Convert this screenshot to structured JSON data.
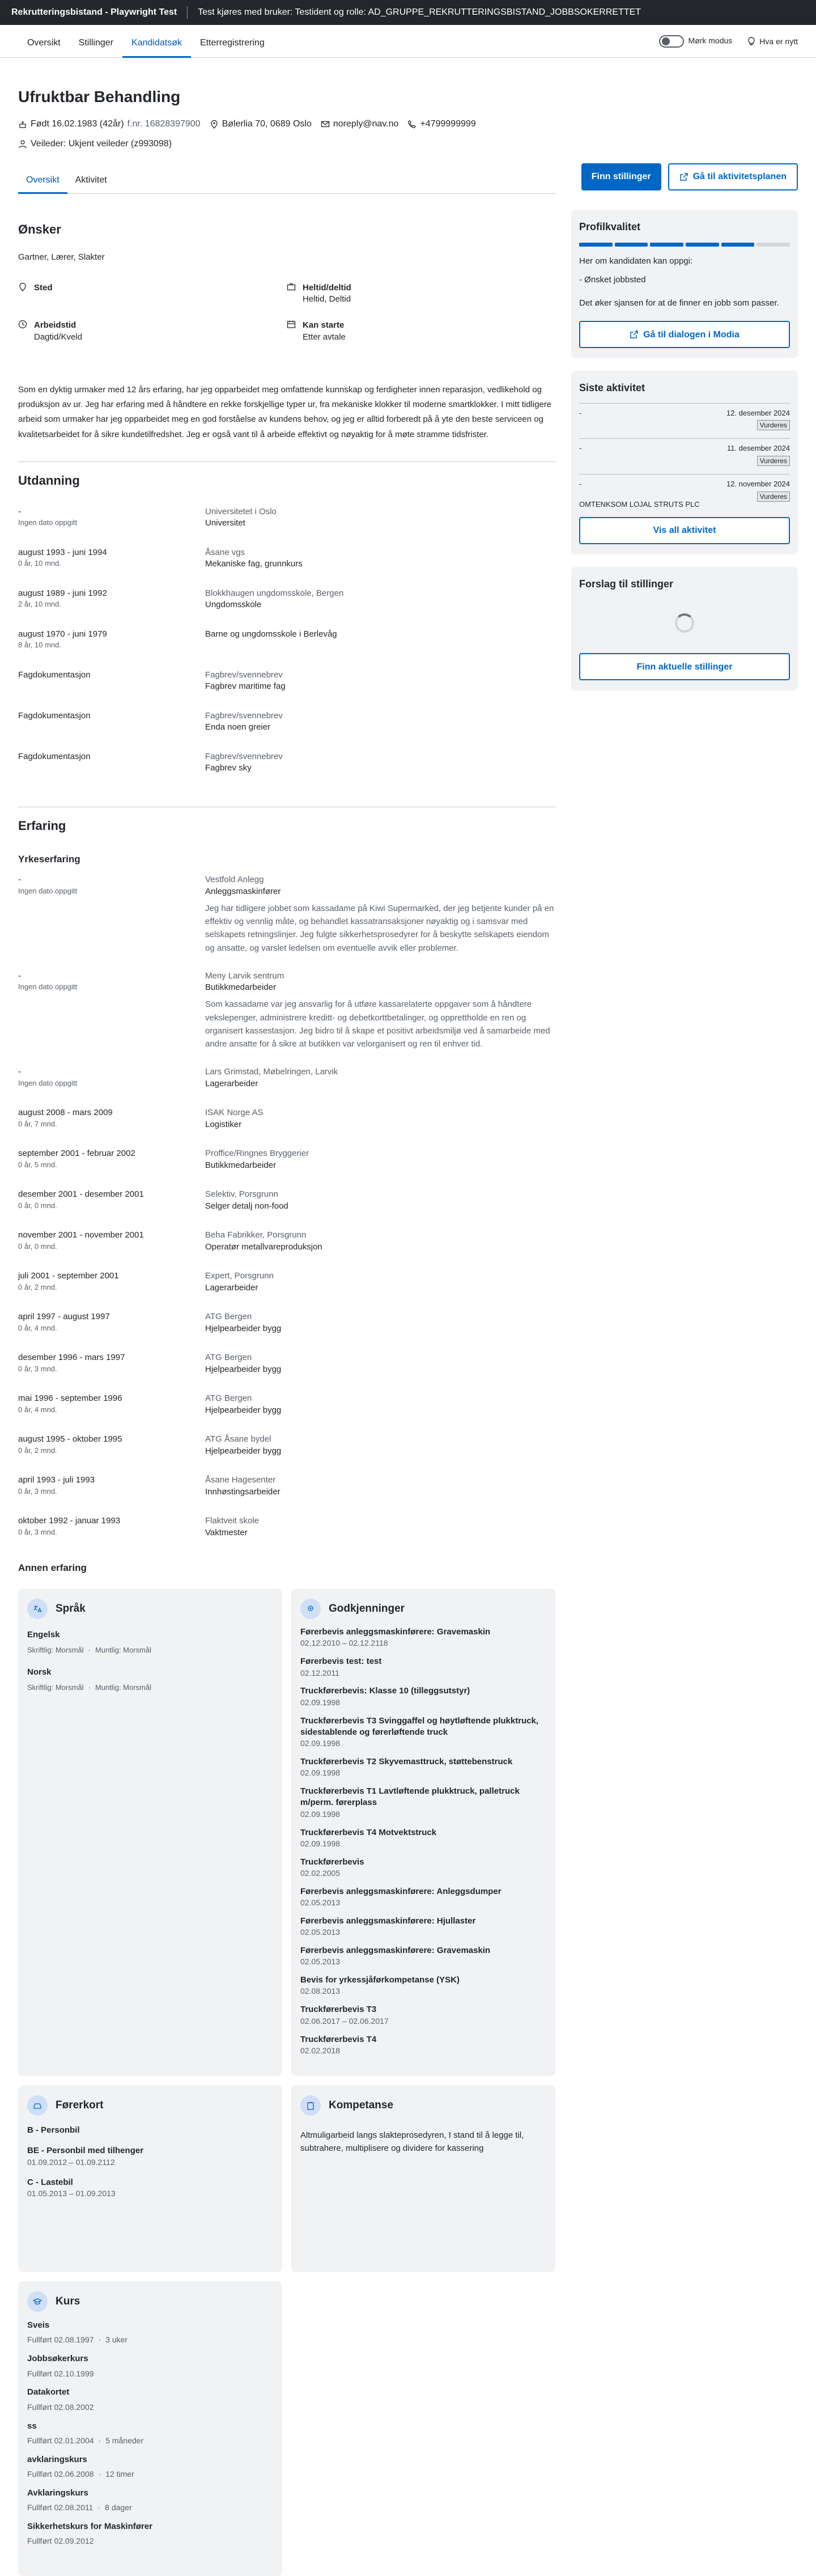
{
  "topbar": {
    "app": "Rekrutteringsbistand - Playwright Test",
    "info": "Test kjøres med bruker: Testident og rolle: AD_GRUPPE_REKRUTTERINGSBISTAND_JOBBSOKERRETTET"
  },
  "nav": {
    "tabs": [
      "Oversikt",
      "Stillinger",
      "Kandidatsøk",
      "Etterregistrering"
    ],
    "active": 2,
    "dark_mode": "Mørk modus",
    "whats_new": "Hva er nytt"
  },
  "candidate": {
    "name": "Ufruktbar Behandling",
    "born": "Født 16.02.1983 (42år)",
    "fnr": "f.nr. 16828397900",
    "address": "Bølerlia 70, 0689 Oslo",
    "email": "noreply@nav.no",
    "phone": "+4799999999",
    "veileder": "Veileder: Ukjent veileder (z993098)"
  },
  "subtabs": [
    "Oversikt",
    "Aktivitet"
  ],
  "buttons": {
    "find_jobs": "Finn stillinger",
    "activity_plan": "Gå til aktivitetsplanen"
  },
  "wishes": {
    "heading": "Ønsker",
    "jobs": "Gartner, Lærer, Slakter",
    "place_label": "Sted",
    "place_value": "",
    "work_label": "Heltid/deltid",
    "work_value": "Heltid, Deltid",
    "time_label": "Arbeidstid",
    "time_value": "Dagtid/Kveld",
    "start_label": "Kan starte",
    "start_value": "Etter avtale"
  },
  "about": "Som en dyktig urmaker med 12 års erfaring, har jeg opparbeidet meg omfattende kunnskap og ferdigheter innen reparasjon, vedlikehold og produksjon av ur. Jeg har erfaring med å håndtere en rekke forskjellige typer ur, fra mekaniske klokker til moderne smartklokker. I mitt tidligere arbeid som urmaker har jeg opparbeidet meg en god forståelse av kundens behov, og jeg er alltid forberedt på å yte den beste serviceen og kvalitetsarbeidet for å sikre kundetilfredshet. Jeg er også vant til å arbeide effektivt og nøyaktig for å møte stramme tidsfrister.",
  "education": {
    "heading": "Utdanning",
    "items": [
      {
        "date": "-",
        "sub": "Ingen dato oppgitt",
        "org": "Universitetet i Oslo",
        "title": "Universitet"
      },
      {
        "date": "august 1993 - juni 1994",
        "sub": "0 år, 10 mnd.",
        "org": "Åsane vgs",
        "title": "Mekaniske fag, grunnkurs"
      },
      {
        "date": "august 1989 - juni 1992",
        "sub": "2 år, 10 mnd.",
        "org": "Blokkhaugen ungdomsskole, Bergen",
        "title": "Ungdomsskole"
      },
      {
        "date": "august 1970 - juni 1979",
        "sub": "8 år, 10 mnd.",
        "org": "",
        "title": "Barne og ungdomsskole i Berlevåg"
      },
      {
        "date": "Fagdokumentasjon",
        "sub": "",
        "org": "Fagbrev/svennebrev",
        "title": "Fagbrev maritime fag"
      },
      {
        "date": "Fagdokumentasjon",
        "sub": "",
        "org": "Fagbrev/svennebrev",
        "title": "Enda noen greier"
      },
      {
        "date": "Fagdokumentasjon",
        "sub": "",
        "org": "Fagbrev/svennebrev",
        "title": "Fagbrev sky"
      }
    ]
  },
  "experience": {
    "heading": "Erfaring",
    "subheading": "Yrkeserfaring",
    "other": "Annen erfaring",
    "items": [
      {
        "date": "-",
        "sub": "Ingen dato oppgitt",
        "org": "Vestfold Anlegg",
        "title": "Anleggsmaskinfører",
        "desc": "Jeg har tidligere jobbet som kassadame på Kiwi Supermarked, der jeg betjente kunder på en effektiv og vennlig måte, og behandlet kassatransaksjoner nøyaktig og i samsvar med selskapets retningslinjer. Jeg fulgte sikkerhetsprosedyrer for å beskytte selskapets eiendom og ansatte, og varslet ledelsen om eventuelle avvik eller problemer."
      },
      {
        "date": "-",
        "sub": "Ingen dato oppgitt",
        "org": "Meny Larvik sentrum",
        "title": "Butikkmedarbeider",
        "desc": "Som kassadame var jeg ansvarlig for å utføre kassarelaterte oppgaver som å håndtere vekslepenger, administrere kreditt- og debetkorttbetalinger, og opprettholde en ren og organisert kassestasjon. Jeg bidro til å skape et positivt arbeidsmiljø ved å samarbeide med andre ansatte for å sikre at butikken var velorganisert og ren til enhver tid."
      },
      {
        "date": "-",
        "sub": "Ingen dato oppgitt",
        "org": "Lars Grimstad, Møbelringen, Larvik",
        "title": "Lagerarbeider",
        "desc": ""
      },
      {
        "date": "august 2008 - mars 2009",
        "sub": "0 år, 7 mnd.",
        "org": "ISAK Norge AS",
        "title": "Logistiker",
        "desc": ""
      },
      {
        "date": "september 2001 - februar 2002",
        "sub": "0 år, 5 mnd.",
        "org": "Proffice/Ringnes Bryggerier",
        "title": "Butikkmedarbeider",
        "desc": ""
      },
      {
        "date": "desember 2001 - desember 2001",
        "sub": "0 år, 0 mnd.",
        "org": "Selektiv, Porsgrunn",
        "title": "Selger detalj non-food",
        "desc": ""
      },
      {
        "date": "november 2001 - november 2001",
        "sub": "0 år, 0 mnd.",
        "org": "Beha Fabrikker, Porsgrunn",
        "title": "Operatør metallvareproduksjon",
        "desc": ""
      },
      {
        "date": "juli 2001 - september 2001",
        "sub": "0 år, 2 mnd.",
        "org": "Expert, Porsgrunn",
        "title": "Lagerarbeider",
        "desc": ""
      },
      {
        "date": "april 1997 - august 1997",
        "sub": "0 år, 4 mnd.",
        "org": "ATG Bergen",
        "title": "Hjelpearbeider bygg",
        "desc": ""
      },
      {
        "date": "desember 1996 - mars 1997",
        "sub": "0 år, 3 mnd.",
        "org": "ATG Bergen",
        "title": "Hjelpearbeider bygg",
        "desc": ""
      },
      {
        "date": "mai 1996 - september 1996",
        "sub": "0 år, 4 mnd.",
        "org": "ATG Bergen",
        "title": "Hjelpearbeider bygg",
        "desc": ""
      },
      {
        "date": "august 1995 - oktober 1995",
        "sub": "0 år, 2 mnd.",
        "org": "ATG Åsane bydel",
        "title": "Hjelpearbeider bygg",
        "desc": ""
      },
      {
        "date": "april 1993 - juli 1993",
        "sub": "0 år, 3 mnd.",
        "org": "Åsane Hagesenter",
        "title": "Innhøstingsarbeider",
        "desc": ""
      },
      {
        "date": "oktober 1992 - januar 1993",
        "sub": "0 år, 3 mnd.",
        "org": "Flaktveit skole",
        "title": "Vaktmester",
        "desc": ""
      }
    ]
  },
  "languages": {
    "heading": "Språk",
    "items": [
      {
        "name": "Engelsk",
        "written": "Skriftlig: Morsmål",
        "oral": "Muntlig: Morsmål"
      },
      {
        "name": "Norsk",
        "written": "Skriftlig: Morsmål",
        "oral": "Muntlig: Morsmål"
      }
    ]
  },
  "approvals": {
    "heading": "Godkjenninger",
    "items": [
      {
        "name": "Førerbevis anleggsmaskinførere: Gravemaskin",
        "date": "02.12.2010 – 02.12.2118"
      },
      {
        "name": "Førerbevis test: test",
        "date": "02.12.2011"
      },
      {
        "name": "Truckførerbevis: Klasse 10 (tilleggsutstyr)",
        "date": "02.09.1998"
      },
      {
        "name": "Truckførerbevis T3 Svinggaffel og høytløftende plukktruck, sidestablende og førerløftende truck",
        "date": "02.09.1998"
      },
      {
        "name": "Truckførerbevis T2 Skyvemasttruck, støttebenstruck",
        "date": "02.09.1998"
      },
      {
        "name": "Truckførerbevis T1 Lavtløftende plukktruck, palletruck m/perm. førerplass",
        "date": "02.09.1998"
      },
      {
        "name": "Truckførerbevis T4 Motvektstruck",
        "date": "02.09.1998"
      },
      {
        "name": "Truckførerbevis",
        "date": "02.02.2005"
      },
      {
        "name": "Førerbevis anleggsmaskinførere: Anleggsdumper",
        "date": "02.05.2013"
      },
      {
        "name": "Førerbevis anleggsmaskinførere: Hjullaster",
        "date": "02.05.2013"
      },
      {
        "name": "Førerbevis anleggsmaskinførere: Gravemaskin",
        "date": "02.05.2013"
      },
      {
        "name": "Bevis for yrkessjåførkompetanse (YSK)",
        "date": "02.08.2013"
      },
      {
        "name": "Truckførerbevis T3",
        "date": "02.06.2017 – 02.06.2017"
      },
      {
        "name": "Truckførerbevis T4",
        "date": "02.02.2018"
      }
    ]
  },
  "licenses": {
    "heading": "Førerkort",
    "items": [
      {
        "name": "B - Personbil",
        "date": ""
      },
      {
        "name": "BE - Personbil med tilhenger",
        "date": "01.09.2012 – 01.09.2112"
      },
      {
        "name": "C - Lastebil",
        "date": "01.05.2013 – 01.09.2013"
      }
    ]
  },
  "competence": {
    "heading": "Kompetanse",
    "text": "Altmuligarbeid langs slakteprosedyren, I stand til å legge til, subtrahere, multiplisere og dividere for kassering"
  },
  "courses": {
    "heading": "Kurs",
    "items": [
      {
        "name": "Sveis",
        "date": "Fullført 02.08.1997",
        "dur": "3 uker"
      },
      {
        "name": "Jobbsøkerkurs",
        "date": "Fullført 02.10.1999",
        "dur": ""
      },
      {
        "name": "Datakortet",
        "date": "Fullført 02.08.2002",
        "dur": ""
      },
      {
        "name": "ss",
        "date": "Fullført 02.01.2004",
        "dur": "5 måneder"
      },
      {
        "name": "avklaringskurs",
        "date": "Fullført 02.06.2008",
        "dur": "12 timer"
      },
      {
        "name": "Avklaringskurs",
        "date": "Fullført 02.08.2011",
        "dur": "8 dager"
      },
      {
        "name": "Sikkerhetskurs for Maskinfører",
        "date": "Fullført 02.09.2012",
        "dur": ""
      }
    ]
  },
  "profile": {
    "heading": "Profilkvalitet",
    "segments_filled": 5,
    "segments_total": 6,
    "hint": "Her om kandidaten kan oppgi:",
    "missing": "- Ønsket jobbsted",
    "info": "Det øker sjansen for at de finner en jobb som passer.",
    "dialog_btn": "Gå til dialogen i Modia"
  },
  "activity": {
    "heading": "Siste aktivitet",
    "items": [
      {
        "dash": "-",
        "date": "12. desember 2024",
        "badge": "Vurderes",
        "name": ""
      },
      {
        "dash": "-",
        "date": "11. desember 2024",
        "badge": "Vurderes",
        "name": ""
      },
      {
        "dash": "-",
        "date": "12. november 2024",
        "badge": "Vurderes",
        "name": "OMTENKSOM LOJAL STRUTS PLC"
      }
    ],
    "all_btn": "Vis all aktivitet"
  },
  "suggestions": {
    "heading": "Forslag til stillinger",
    "btn": "Finn aktuelle stillinger"
  }
}
